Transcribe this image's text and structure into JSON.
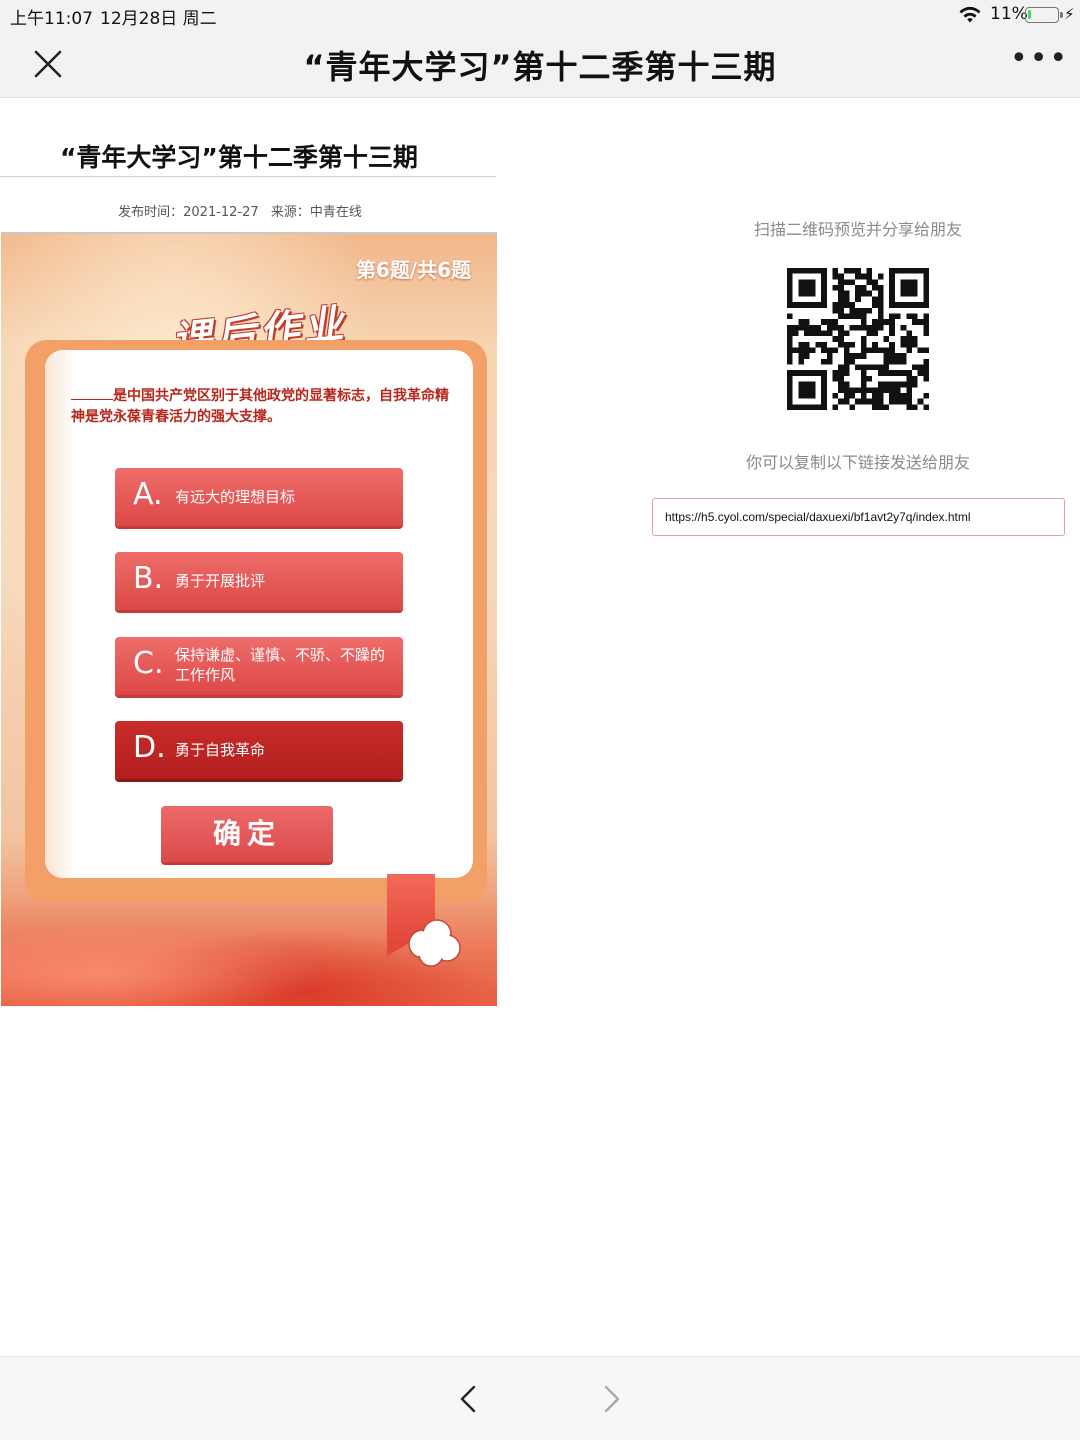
{
  "status_bar": {
    "time": "上午11:07",
    "date": "12月28日 周二",
    "battery_percent": "11%",
    "battery_level": 0.11,
    "icons": [
      "wifi-icon",
      "battery-icon",
      "charging-bolt-icon"
    ]
  },
  "nav": {
    "title": "“青年大学习”第十二季第十三期",
    "close_icon": "close-icon",
    "more_icon": "more-icon",
    "more_glyph": "•••"
  },
  "article": {
    "title": "“青年大学习”第十二季第十三期",
    "publish_label": "发布时间：",
    "publish_date": "2021-12-27",
    "source_label": "来源：",
    "source": "中青在线"
  },
  "quiz": {
    "counter": "第6题/共6题",
    "badge": "课后作业",
    "question_blank": "____",
    "question": "是中国共产党区别于其他政党的显著标志，自我革命精神是党永葆青春活力的强大支撑。",
    "options": [
      {
        "letter": "A.",
        "text": "有远大的理想目标"
      },
      {
        "letter": "B.",
        "text": "勇于开展批评"
      },
      {
        "letter": "C.",
        "text": "保持谦虚、谨慎、不骄、不躁的工作作风"
      },
      {
        "letter": "D.",
        "text": "勇于自我革命"
      }
    ],
    "selected_option": "D",
    "confirm_label": "确定",
    "colors": {
      "option": "#e25755",
      "selected": "#b8231f",
      "question": "#b8271c"
    }
  },
  "share": {
    "qr_hint": "扫描二维码预览并分享给朋友",
    "link_hint": "你可以复制以下链接发送给朋友",
    "url": "https://h5.cyol.com/special/daxuexi/bf1avt2y7q/index.html"
  },
  "toolbar": {
    "back_icon": "chevron-left-icon",
    "forward_icon": "chevron-right-icon"
  }
}
